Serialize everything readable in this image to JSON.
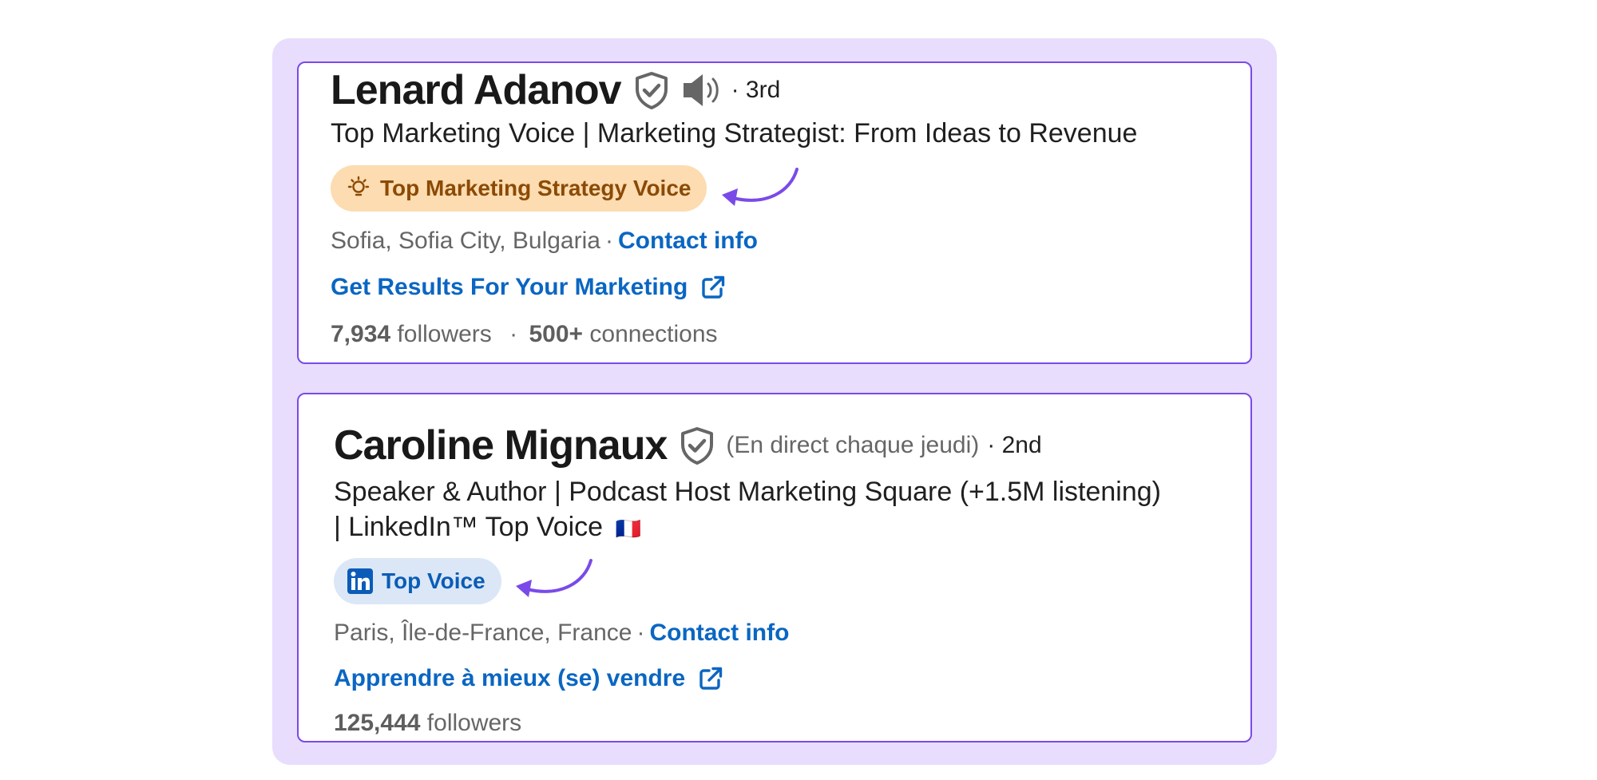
{
  "colors": {
    "panel_background": "#e8ddfd",
    "card_border": "#7a4ae8",
    "link_blue": "#0a66c2",
    "orange_badge_bg": "#fcdcb0",
    "blue_badge_bg": "#dbe7f6",
    "arrow_purple": "#7a4ae8"
  },
  "profiles": [
    {
      "name": "Lenard Adanov",
      "degree": "· 3rd",
      "headline": "Top Marketing Voice | Marketing Strategist: From Ideas to Revenue",
      "badge": {
        "label": "Top Marketing Strategy Voice",
        "icon": "lightbulb-icon"
      },
      "location": "Sofia, Sofia City, Bulgaria",
      "separator": "·",
      "contact_label": "Contact info",
      "website_label": "Get Results For Your Marketing",
      "followers_count": "7,934",
      "followers_label": "followers",
      "connections_count": "500+",
      "connections_label": "connections"
    },
    {
      "name": "Caroline Mignaux",
      "pronouns_note": "(En direct chaque jeudi)",
      "degree": "· 2nd",
      "headline_line1": "Speaker & Author | Podcast Host Marketing Square (+1.5M listening)",
      "headline_line2": "| LinkedIn™ Top Voice",
      "flag": "🇫🇷",
      "badge": {
        "label": "Top Voice",
        "icon": "linkedin-icon"
      },
      "location": "Paris, Île-de-France, France",
      "separator": "·",
      "contact_label": "Contact info",
      "website_label": "Apprendre à mieux (se) vendre",
      "followers_count": "125,444",
      "followers_label": "followers"
    }
  ]
}
